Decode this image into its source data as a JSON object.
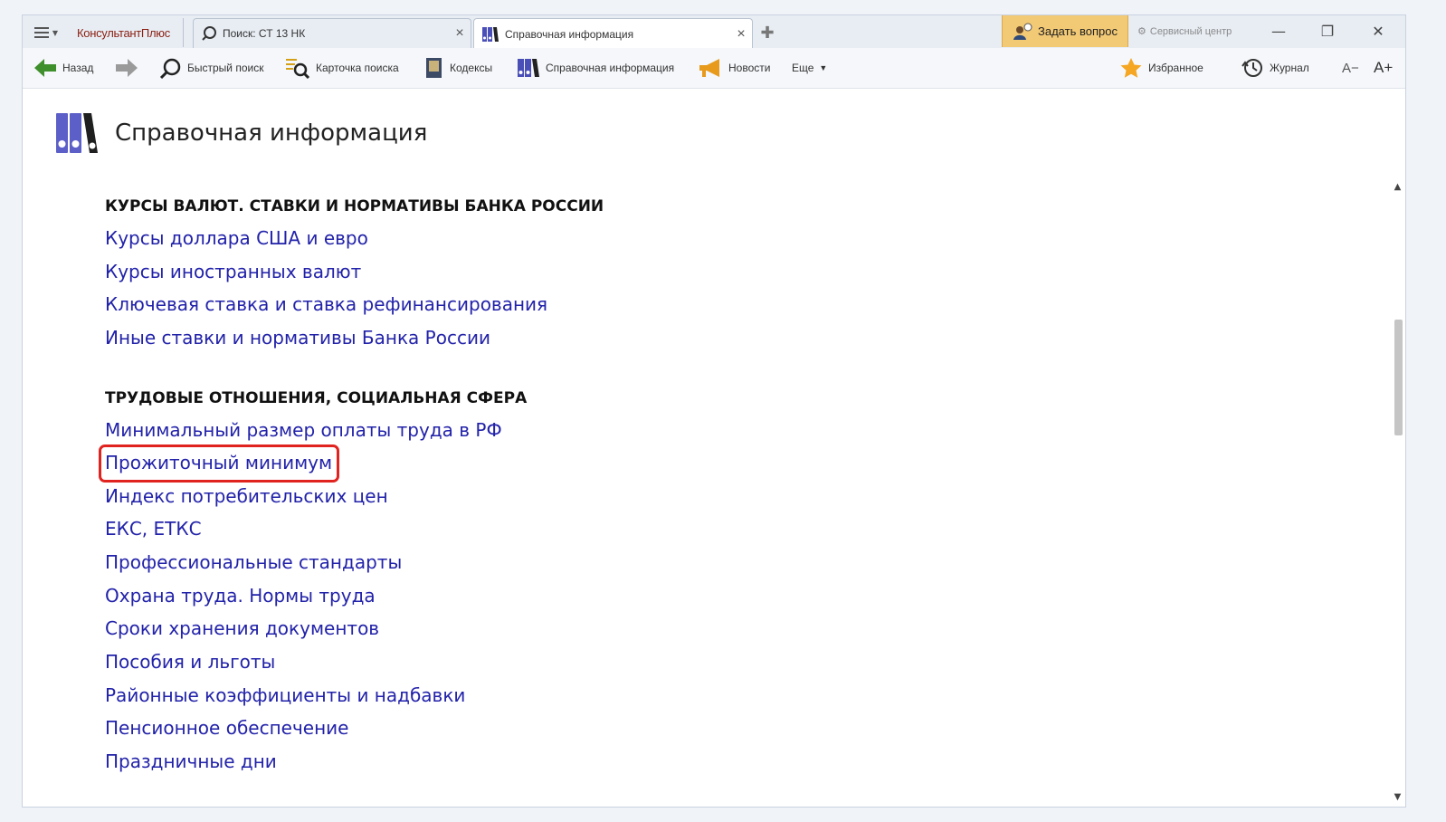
{
  "tabbar": {
    "logo_text": "КонсультантПлюс",
    "tabs": [
      {
        "label": "Поиск: СТ 13 НК",
        "icon": "search-icon"
      },
      {
        "label": "Справочная информация",
        "icon": "binders-icon",
        "active": true
      }
    ],
    "ask_question": "Задать вопрос",
    "service_center": "Сервисный центр"
  },
  "toolbar": {
    "back": "Назад",
    "quick_search": "Быстрый поиск",
    "search_card": "Карточка поиска",
    "codes": "Кодексы",
    "reference": "Справочная информация",
    "news": "Новости",
    "more": "Еще",
    "favorites": "Избранное",
    "journal": "Журнал",
    "font_decrease": "A−",
    "font_increase": "A+"
  },
  "page": {
    "title": "Справочная информация",
    "sections": [
      {
        "title": "КУРСЫ ВАЛЮТ. СТАВКИ И НОРМАТИВЫ БАНКА РОССИИ",
        "links": [
          "Курсы доллара США и евро",
          "Курсы иностранных валют",
          "Ключевая ставка и ставка рефинансирования",
          "Иные ставки и нормативы Банка России"
        ]
      },
      {
        "title": "ТРУДОВЫЕ ОТНОШЕНИЯ, СОЦИАЛЬНАЯ СФЕРА",
        "links": [
          "Минимальный размер оплаты труда в РФ",
          "Прожиточный минимум",
          "Индекс потребительских цен",
          "ЕКС, ЕТКС",
          "Профессиональные стандарты",
          "Охрана труда. Нормы труда",
          "Сроки хранения документов",
          "Пособия и льготы",
          "Районные коэффициенты и надбавки",
          "Пенсионное обеспечение",
          "Праздничные дни"
        ]
      }
    ]
  },
  "colors": {
    "link": "#2222aa",
    "highlight": "#e1231f",
    "ask_button": "#f2c975",
    "icon_purple": "#5b5fc7"
  }
}
